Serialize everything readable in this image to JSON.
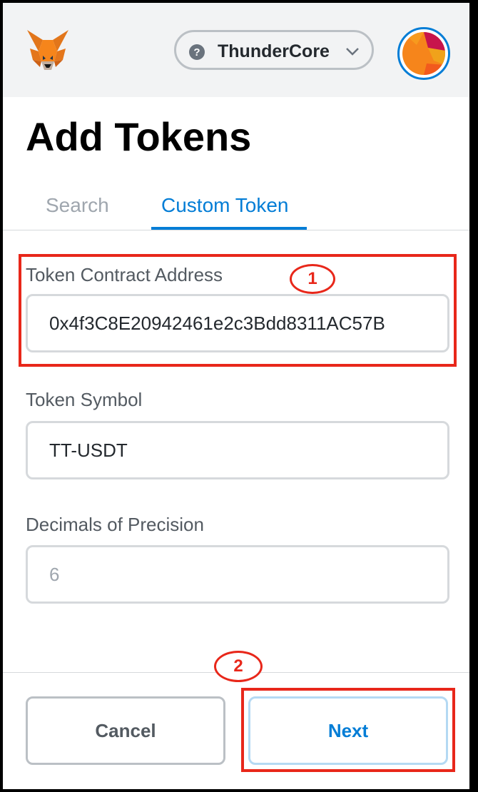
{
  "header": {
    "network": {
      "label": "ThunderCore",
      "help_icon": "question-circle-icon",
      "dropdown_icon": "chevron-down-icon"
    },
    "logo_icon": "metamask-fox-icon",
    "account_icon": "account-avatar"
  },
  "page": {
    "title": "Add Tokens"
  },
  "tabs": [
    {
      "label": "Search",
      "active": false
    },
    {
      "label": "Custom Token",
      "active": true
    }
  ],
  "form": {
    "contract_address": {
      "label": "Token Contract Address",
      "value": "0x4f3C8E20942461e2c3Bdd8311AC57B"
    },
    "symbol": {
      "label": "Token Symbol",
      "value": "TT-USDT"
    },
    "decimals": {
      "label": "Decimals of Precision",
      "value": "6"
    }
  },
  "annotations": {
    "step1": "1",
    "step2": "2",
    "highlight_color": "#e8271a"
  },
  "buttons": {
    "cancel": "Cancel",
    "next": "Next"
  },
  "colors": {
    "accent": "#037dd6",
    "header_bg": "#f2f3f4"
  }
}
